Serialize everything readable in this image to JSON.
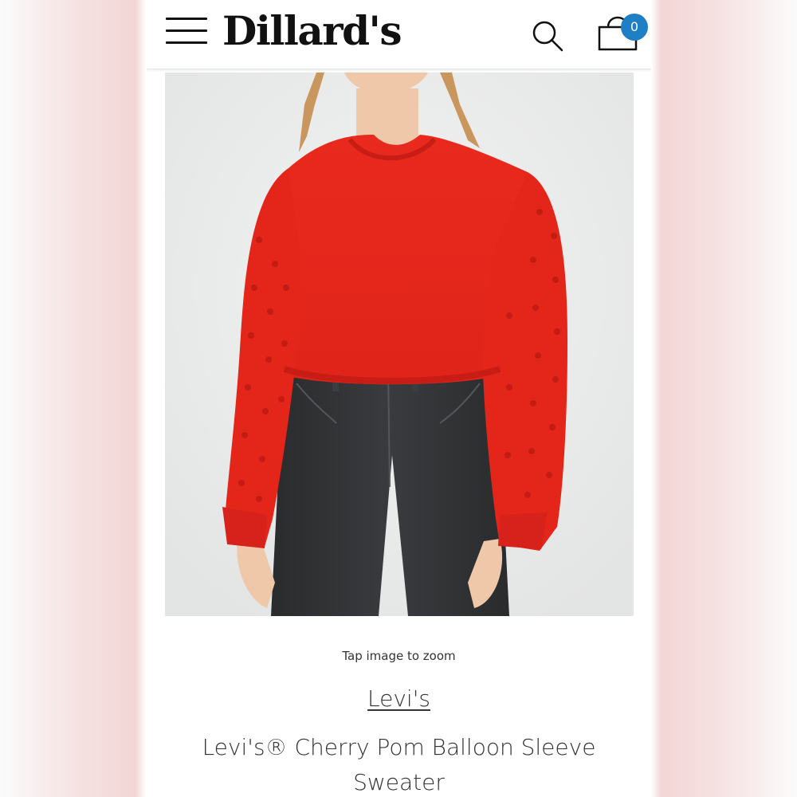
{
  "header": {
    "logo_text": "Dillard's",
    "cart_count": "0",
    "icons": {
      "menu": "hamburger-menu-icon",
      "search": "search-icon",
      "cart": "shopping-bag-icon"
    },
    "badge_color": "#1f7fc4"
  },
  "product": {
    "zoom_hint": "Tap image to zoom",
    "brand": "Levi's",
    "title": "Levi's® Cherry Pom Balloon Sleeve Sweater",
    "sweater_color": "#e8271c"
  }
}
